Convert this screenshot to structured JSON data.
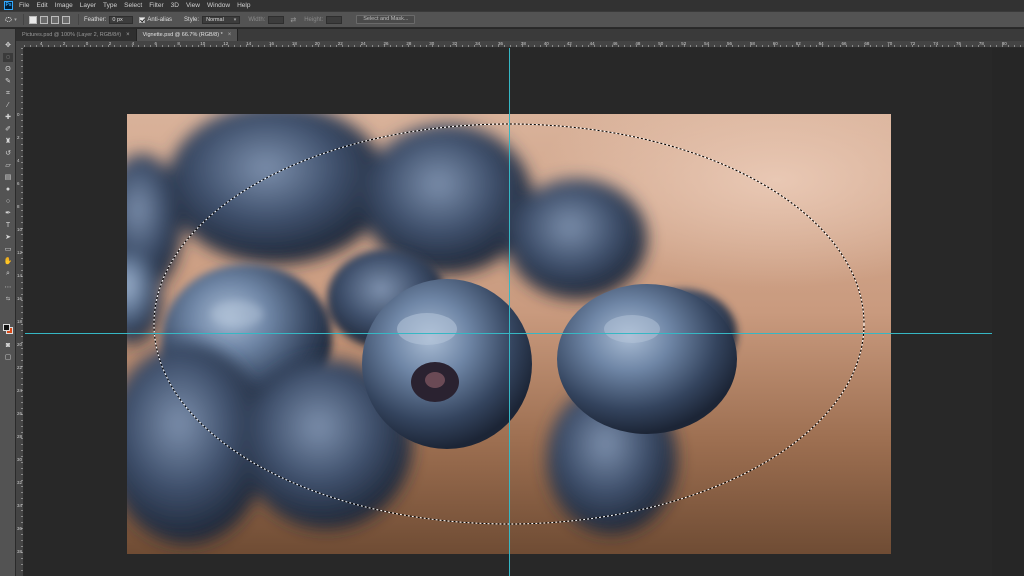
{
  "app": {
    "logo_text": "Ps",
    "menu": [
      "File",
      "Edit",
      "Image",
      "Layer",
      "Type",
      "Select",
      "Filter",
      "3D",
      "View",
      "Window",
      "Help"
    ]
  },
  "options": {
    "feather_label": "Feather:",
    "feather_value": "0 px",
    "antialias_label": "Anti-alias",
    "style_label": "Style:",
    "style_value": "Normal",
    "width_label": "Width:",
    "height_label": "Height:",
    "select_mask_label": "Select and Mask..."
  },
  "tabs": [
    {
      "title": "Pictures.psd @ 100% (Layer 2, RGB/8#)",
      "close": "×",
      "active": false
    },
    {
      "title": "Vignette.psd @ 66.7% (RGB/8) *",
      "close": "×",
      "active": true
    }
  ],
  "ruler": {
    "h_numbers": [
      "4",
      "2",
      "0",
      "2",
      "4",
      "6",
      "8",
      "10",
      "12",
      "14",
      "16",
      "18",
      "20",
      "22",
      "24",
      "26",
      "28",
      "30",
      "32",
      "34",
      "36",
      "38",
      "40",
      "42",
      "44",
      "46",
      "48",
      "50",
      "52",
      "54",
      "56",
      "58",
      "60",
      "62",
      "64",
      "66",
      "68",
      "70",
      "72",
      "74",
      "76",
      "78",
      "80"
    ],
    "v_numbers": [
      "0",
      "2",
      "4",
      "6",
      "8",
      "10",
      "12",
      "14",
      "16",
      "18",
      "20",
      "22",
      "24",
      "26",
      "28",
      "30",
      "32",
      "34",
      "36",
      "38",
      "40",
      "42",
      "44"
    ]
  },
  "colors": {
    "foreground": "#111111",
    "background": "#d94a18",
    "guide": "#36b7c4"
  },
  "tools": [
    "move-icon",
    "marquee-icon",
    "lasso-icon",
    "quick-select-icon",
    "crop-icon",
    "eyedropper-icon",
    "healing-icon",
    "brush-icon",
    "clone-stamp-icon",
    "history-brush-icon",
    "eraser-icon",
    "gradient-icon",
    "blur-icon",
    "dodge-icon",
    "pen-icon",
    "type-icon",
    "path-select-icon",
    "shape-icon",
    "hand-icon",
    "zoom-icon",
    "more-icon"
  ]
}
